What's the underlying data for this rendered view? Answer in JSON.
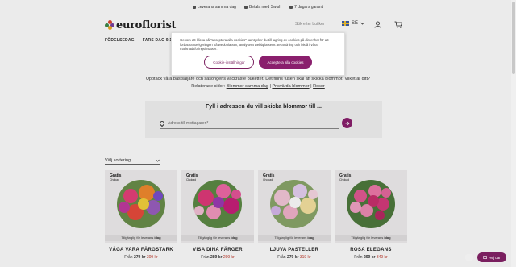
{
  "topbar": {
    "items": [
      "Leverans samma dag",
      "Betala med Swish",
      "7 dagars garanti"
    ]
  },
  "header": {
    "logo_text": "euroflorist",
    "search_text": "Sök efter butiker",
    "lang": "SE",
    "icons": [
      "flag-se-icon",
      "user-icon",
      "cart-icon"
    ]
  },
  "nav": {
    "items": [
      "FÖDELSEDAG",
      "FARS DAG 9/11"
    ]
  },
  "cookie": {
    "text": "Genom att klicka på \"acceptera alla cookies\" samtycker du till lagring av cookies på din enhet för att förbättra navigeringen på webbplatsen, analysera webbplatsens användning och bistå i våra marknadsföringsinsatser.",
    "settings_label": "Cookie-inställningar",
    "accept_label": "Acceptera alla cookies"
  },
  "intro": {
    "line1": "Upptäck våra bästsäljare och säsongens vackraste buketter. Det finns tusen skäl att skicka blommor. Vilket är ditt?",
    "related_label": "Relaterade sidor:",
    "related_links": [
      "Blommor samma dag",
      "Prisvärda blommor",
      "Rosor"
    ]
  },
  "address": {
    "title": "Fyll i adressen du vill skicka blommor till ...",
    "placeholder": "Adress till mottagaren*"
  },
  "sort": {
    "label": "Välj sortering"
  },
  "products": [
    {
      "name": "VÅGA VARA FÄRGSTARK",
      "from": "Från",
      "price": "279 kr",
      "old": "309 kr",
      "badge": "Gratis",
      "badge_sub": "Chokad",
      "avail": "Tillgänglig för leverans",
      "avail_day": "idag"
    },
    {
      "name": "VISA DINA FÄRGER",
      "from": "Från",
      "price": "289 kr",
      "old": "299 kr",
      "badge": "Gratis",
      "badge_sub": "Chokad",
      "avail": "Tillgänglig för leverans",
      "avail_day": "idag"
    },
    {
      "name": "LJUVA PASTELLER",
      "from": "Från",
      "price": "279 kr",
      "old": "319 kr",
      "badge": "Gratis",
      "badge_sub": "Chokad",
      "avail": "Tillgänglig för leverans",
      "avail_day": "idag"
    },
    {
      "name": "ROSA ELEGANS",
      "from": "Från",
      "price": "299 kr",
      "old": "349 kr",
      "badge": "Gratis",
      "badge_sub": "Chokad",
      "avail": "Tillgänglig för leverans",
      "avail_day": "idag"
    }
  ],
  "chat": {
    "label": "Hej där"
  },
  "colors": {
    "brand": "#8a1f6d",
    "old_price": "#c0392b"
  }
}
